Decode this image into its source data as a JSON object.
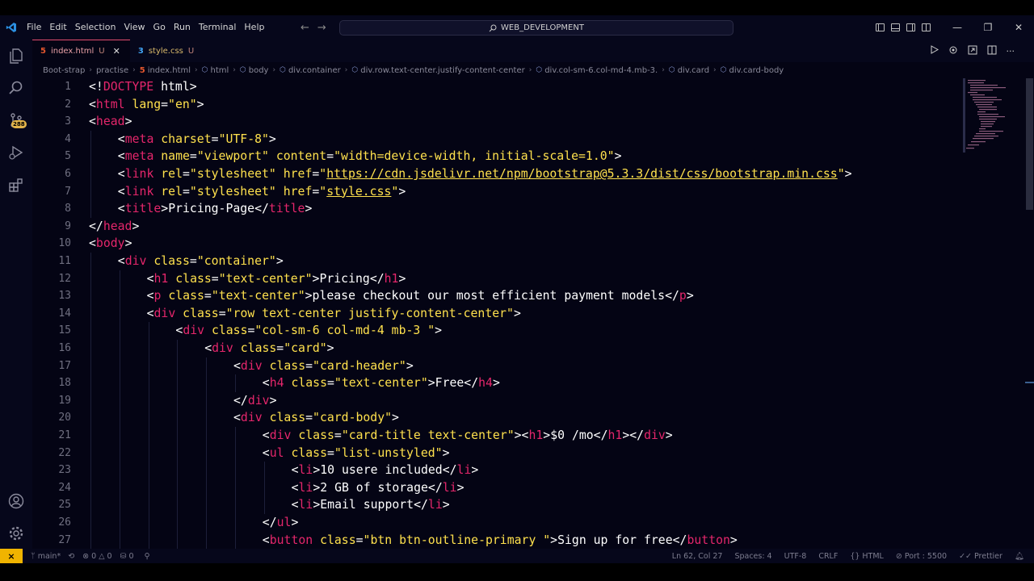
{
  "titlebar": {
    "menu": [
      "File",
      "Edit",
      "Selection",
      "View",
      "Go",
      "Run",
      "Terminal",
      "Help"
    ],
    "search_text": "WEB_DEVELOPMENT"
  },
  "activity": {
    "badge": "288"
  },
  "tabs": [
    {
      "label": "index.html",
      "status": "U",
      "icon": "html-file-icon",
      "active": true
    },
    {
      "label": "style.css",
      "status": "U",
      "icon": "css-file-icon",
      "active": false
    }
  ],
  "breadcrumb": [
    "Boot-strap",
    "practise",
    "index.html",
    "html",
    "body",
    "div.container",
    "div.row.text-center.justify-content-center",
    "div.col-sm-6.col-md-4.mb-3.",
    "div.card",
    "div.card-body"
  ],
  "editor": {
    "line_numbers": [
      "1",
      "2",
      "3",
      "4",
      "5",
      "6",
      "7",
      "8",
      "9",
      "10",
      "11",
      "12",
      "13",
      "14",
      "15",
      "16",
      "17",
      "18",
      "19",
      "20",
      "21",
      "22",
      "23",
      "24",
      "25",
      "26",
      "27"
    ],
    "lines": [
      {
        "indent": 0,
        "tokens": [
          {
            "t": "<!",
            "c": "p"
          },
          {
            "t": "DOCTYPE",
            "c": "t"
          },
          {
            "t": " html",
            "c": "w"
          },
          {
            "t": ">",
            "c": "p"
          }
        ]
      },
      {
        "indent": 0,
        "tokens": [
          {
            "t": "<",
            "c": "p"
          },
          {
            "t": "html",
            "c": "t"
          },
          {
            "t": " lang",
            "c": "a"
          },
          {
            "t": "=",
            "c": "p"
          },
          {
            "t": "\"en\"",
            "c": "s"
          },
          {
            "t": ">",
            "c": "p"
          }
        ]
      },
      {
        "indent": 0,
        "tokens": [
          {
            "t": "<",
            "c": "p"
          },
          {
            "t": "head",
            "c": "t"
          },
          {
            "t": ">",
            "c": "p"
          }
        ]
      },
      {
        "indent": 1,
        "tokens": [
          {
            "t": "<",
            "c": "p"
          },
          {
            "t": "meta",
            "c": "t"
          },
          {
            "t": " charset",
            "c": "a"
          },
          {
            "t": "=",
            "c": "p"
          },
          {
            "t": "\"UTF-8\"",
            "c": "s"
          },
          {
            "t": ">",
            "c": "p"
          }
        ]
      },
      {
        "indent": 1,
        "tokens": [
          {
            "t": "<",
            "c": "p"
          },
          {
            "t": "meta",
            "c": "t"
          },
          {
            "t": " name",
            "c": "a"
          },
          {
            "t": "=",
            "c": "p"
          },
          {
            "t": "\"viewport\"",
            "c": "s"
          },
          {
            "t": " content",
            "c": "a"
          },
          {
            "t": "=",
            "c": "p"
          },
          {
            "t": "\"width=device-width, initial-scale=1.0\"",
            "c": "s"
          },
          {
            "t": ">",
            "c": "p"
          }
        ]
      },
      {
        "indent": 1,
        "tokens": [
          {
            "t": "<",
            "c": "p"
          },
          {
            "t": "link",
            "c": "t"
          },
          {
            "t": " rel",
            "c": "a"
          },
          {
            "t": "=",
            "c": "p"
          },
          {
            "t": "\"stylesheet\"",
            "c": "s"
          },
          {
            "t": " href",
            "c": "a"
          },
          {
            "t": "=",
            "c": "p"
          },
          {
            "t": "\"",
            "c": "s"
          },
          {
            "t": "https://cdn.jsdelivr.net/npm/bootstrap@5.3.3/dist/css/bootstrap.min.css",
            "c": "u"
          },
          {
            "t": "\"",
            "c": "s"
          },
          {
            "t": ">",
            "c": "p"
          }
        ]
      },
      {
        "indent": 1,
        "tokens": [
          {
            "t": "<",
            "c": "p"
          },
          {
            "t": "link",
            "c": "t"
          },
          {
            "t": " rel",
            "c": "a"
          },
          {
            "t": "=",
            "c": "p"
          },
          {
            "t": "\"stylesheet\"",
            "c": "s"
          },
          {
            "t": " href",
            "c": "a"
          },
          {
            "t": "=",
            "c": "p"
          },
          {
            "t": "\"",
            "c": "s"
          },
          {
            "t": "style.css",
            "c": "u"
          },
          {
            "t": "\"",
            "c": "s"
          },
          {
            "t": ">",
            "c": "p"
          }
        ]
      },
      {
        "indent": 1,
        "tokens": [
          {
            "t": "<",
            "c": "p"
          },
          {
            "t": "title",
            "c": "t"
          },
          {
            "t": ">",
            "c": "p"
          },
          {
            "t": "Pricing-Page",
            "c": "w"
          },
          {
            "t": "</",
            "c": "p"
          },
          {
            "t": "title",
            "c": "t"
          },
          {
            "t": ">",
            "c": "p"
          }
        ]
      },
      {
        "indent": 0,
        "tokens": [
          {
            "t": "</",
            "c": "p"
          },
          {
            "t": "head",
            "c": "t"
          },
          {
            "t": ">",
            "c": "p"
          }
        ]
      },
      {
        "indent": 0,
        "tokens": [
          {
            "t": "<",
            "c": "p"
          },
          {
            "t": "body",
            "c": "t"
          },
          {
            "t": ">",
            "c": "p"
          }
        ]
      },
      {
        "indent": 1,
        "tokens": [
          {
            "t": "<",
            "c": "p"
          },
          {
            "t": "div",
            "c": "t"
          },
          {
            "t": " class",
            "c": "a"
          },
          {
            "t": "=",
            "c": "p"
          },
          {
            "t": "\"container\"",
            "c": "s"
          },
          {
            "t": ">",
            "c": "p"
          }
        ]
      },
      {
        "indent": 2,
        "tokens": [
          {
            "t": "<",
            "c": "p"
          },
          {
            "t": "h1",
            "c": "t"
          },
          {
            "t": " class",
            "c": "a"
          },
          {
            "t": "=",
            "c": "p"
          },
          {
            "t": "\"text-center\"",
            "c": "s"
          },
          {
            "t": ">",
            "c": "p"
          },
          {
            "t": "Pricing",
            "c": "w"
          },
          {
            "t": "</",
            "c": "p"
          },
          {
            "t": "h1",
            "c": "t"
          },
          {
            "t": ">",
            "c": "p"
          }
        ]
      },
      {
        "indent": 2,
        "tokens": [
          {
            "t": "<",
            "c": "p"
          },
          {
            "t": "p",
            "c": "t"
          },
          {
            "t": " class",
            "c": "a"
          },
          {
            "t": "=",
            "c": "p"
          },
          {
            "t": "\"text-center\"",
            "c": "s"
          },
          {
            "t": ">",
            "c": "p"
          },
          {
            "t": "please checkout our most efficient payment models",
            "c": "w"
          },
          {
            "t": "</",
            "c": "p"
          },
          {
            "t": "p",
            "c": "t"
          },
          {
            "t": ">",
            "c": "p"
          }
        ]
      },
      {
        "indent": 2,
        "tokens": [
          {
            "t": "<",
            "c": "p"
          },
          {
            "t": "div",
            "c": "t"
          },
          {
            "t": " class",
            "c": "a"
          },
          {
            "t": "=",
            "c": "p"
          },
          {
            "t": "\"row text-center justify-content-center\"",
            "c": "s"
          },
          {
            "t": ">",
            "c": "p"
          }
        ]
      },
      {
        "indent": 3,
        "tokens": [
          {
            "t": "<",
            "c": "p"
          },
          {
            "t": "div",
            "c": "t"
          },
          {
            "t": " class",
            "c": "a"
          },
          {
            "t": "=",
            "c": "p"
          },
          {
            "t": "\"col-sm-6 col-md-4 mb-3 \"",
            "c": "s"
          },
          {
            "t": ">",
            "c": "p"
          }
        ]
      },
      {
        "indent": 4,
        "tokens": [
          {
            "t": "<",
            "c": "p"
          },
          {
            "t": "div",
            "c": "t"
          },
          {
            "t": " class",
            "c": "a"
          },
          {
            "t": "=",
            "c": "p"
          },
          {
            "t": "\"card\"",
            "c": "s"
          },
          {
            "t": ">",
            "c": "p"
          }
        ]
      },
      {
        "indent": 5,
        "tokens": [
          {
            "t": "<",
            "c": "p"
          },
          {
            "t": "div",
            "c": "t"
          },
          {
            "t": " class",
            "c": "a"
          },
          {
            "t": "=",
            "c": "p"
          },
          {
            "t": "\"card-header\"",
            "c": "s"
          },
          {
            "t": ">",
            "c": "p"
          }
        ]
      },
      {
        "indent": 6,
        "tokens": [
          {
            "t": "<",
            "c": "p"
          },
          {
            "t": "h4",
            "c": "t"
          },
          {
            "t": " class",
            "c": "a"
          },
          {
            "t": "=",
            "c": "p"
          },
          {
            "t": "\"text-center\"",
            "c": "s"
          },
          {
            "t": ">",
            "c": "p"
          },
          {
            "t": "Free",
            "c": "w"
          },
          {
            "t": "</",
            "c": "p"
          },
          {
            "t": "h4",
            "c": "t"
          },
          {
            "t": ">",
            "c": "p"
          }
        ]
      },
      {
        "indent": 5,
        "tokens": [
          {
            "t": "</",
            "c": "p"
          },
          {
            "t": "div",
            "c": "t"
          },
          {
            "t": ">",
            "c": "p"
          }
        ]
      },
      {
        "indent": 5,
        "tokens": [
          {
            "t": "<",
            "c": "p"
          },
          {
            "t": "div",
            "c": "t"
          },
          {
            "t": " class",
            "c": "a"
          },
          {
            "t": "=",
            "c": "p"
          },
          {
            "t": "\"card-body\"",
            "c": "s"
          },
          {
            "t": ">",
            "c": "p"
          }
        ]
      },
      {
        "indent": 6,
        "tokens": [
          {
            "t": "<",
            "c": "p"
          },
          {
            "t": "div",
            "c": "t"
          },
          {
            "t": " class",
            "c": "a"
          },
          {
            "t": "=",
            "c": "p"
          },
          {
            "t": "\"card-title text-center\"",
            "c": "s"
          },
          {
            "t": "><",
            "c": "p"
          },
          {
            "t": "h1",
            "c": "t"
          },
          {
            "t": ">",
            "c": "p"
          },
          {
            "t": "$0 /mo",
            "c": "w"
          },
          {
            "t": "</",
            "c": "p"
          },
          {
            "t": "h1",
            "c": "t"
          },
          {
            "t": "></",
            "c": "p"
          },
          {
            "t": "div",
            "c": "t"
          },
          {
            "t": ">",
            "c": "p"
          }
        ]
      },
      {
        "indent": 6,
        "tokens": [
          {
            "t": "<",
            "c": "p"
          },
          {
            "t": "ul",
            "c": "t"
          },
          {
            "t": " class",
            "c": "a"
          },
          {
            "t": "=",
            "c": "p"
          },
          {
            "t": "\"list-unstyled\"",
            "c": "s"
          },
          {
            "t": ">",
            "c": "p"
          }
        ]
      },
      {
        "indent": 7,
        "tokens": [
          {
            "t": "<",
            "c": "p"
          },
          {
            "t": "li",
            "c": "t"
          },
          {
            "t": ">",
            "c": "p"
          },
          {
            "t": "10 usere included",
            "c": "w"
          },
          {
            "t": "</",
            "c": "p"
          },
          {
            "t": "li",
            "c": "t"
          },
          {
            "t": ">",
            "c": "p"
          }
        ]
      },
      {
        "indent": 7,
        "tokens": [
          {
            "t": "<",
            "c": "p"
          },
          {
            "t": "li",
            "c": "t"
          },
          {
            "t": ">",
            "c": "p"
          },
          {
            "t": "2 GB of storage",
            "c": "w"
          },
          {
            "t": "</",
            "c": "p"
          },
          {
            "t": "li",
            "c": "t"
          },
          {
            "t": ">",
            "c": "p"
          }
        ]
      },
      {
        "indent": 7,
        "tokens": [
          {
            "t": "<",
            "c": "p"
          },
          {
            "t": "li",
            "c": "t"
          },
          {
            "t": ">",
            "c": "p"
          },
          {
            "t": "Email support",
            "c": "w"
          },
          {
            "t": "</",
            "c": "p"
          },
          {
            "t": "li",
            "c": "t"
          },
          {
            "t": ">",
            "c": "p"
          }
        ]
      },
      {
        "indent": 6,
        "tokens": [
          {
            "t": "</",
            "c": "p"
          },
          {
            "t": "ul",
            "c": "t"
          },
          {
            "t": ">",
            "c": "p"
          }
        ]
      },
      {
        "indent": 6,
        "tokens": [
          {
            "t": "<",
            "c": "p"
          },
          {
            "t": "button",
            "c": "t"
          },
          {
            "t": " class",
            "c": "a"
          },
          {
            "t": "=",
            "c": "p"
          },
          {
            "t": "\"btn btn-outline-primary \"",
            "c": "s"
          },
          {
            "t": ">",
            "c": "p"
          },
          {
            "t": "Sign up for free",
            "c": "w"
          },
          {
            "t": "</",
            "c": "p"
          },
          {
            "t": "button",
            "c": "t"
          },
          {
            "t": ">",
            "c": "p"
          }
        ]
      }
    ]
  },
  "statusbar": {
    "branch": "main*",
    "errors": "0",
    "warnings": "0",
    "ports": "0",
    "cursor": "Ln 62, Col 27",
    "spaces": "Spaces: 4",
    "encoding": "UTF-8",
    "eol": "CRLF",
    "language": "HTML",
    "port": "Port : 5500",
    "formatter": "Prettier"
  },
  "colors": {
    "tag": "#e5266b",
    "attribute": "#ffe14d",
    "string": "#ffe14d",
    "text": "#ffffff",
    "punct": "#ffffff",
    "accent": "#f0b400"
  }
}
